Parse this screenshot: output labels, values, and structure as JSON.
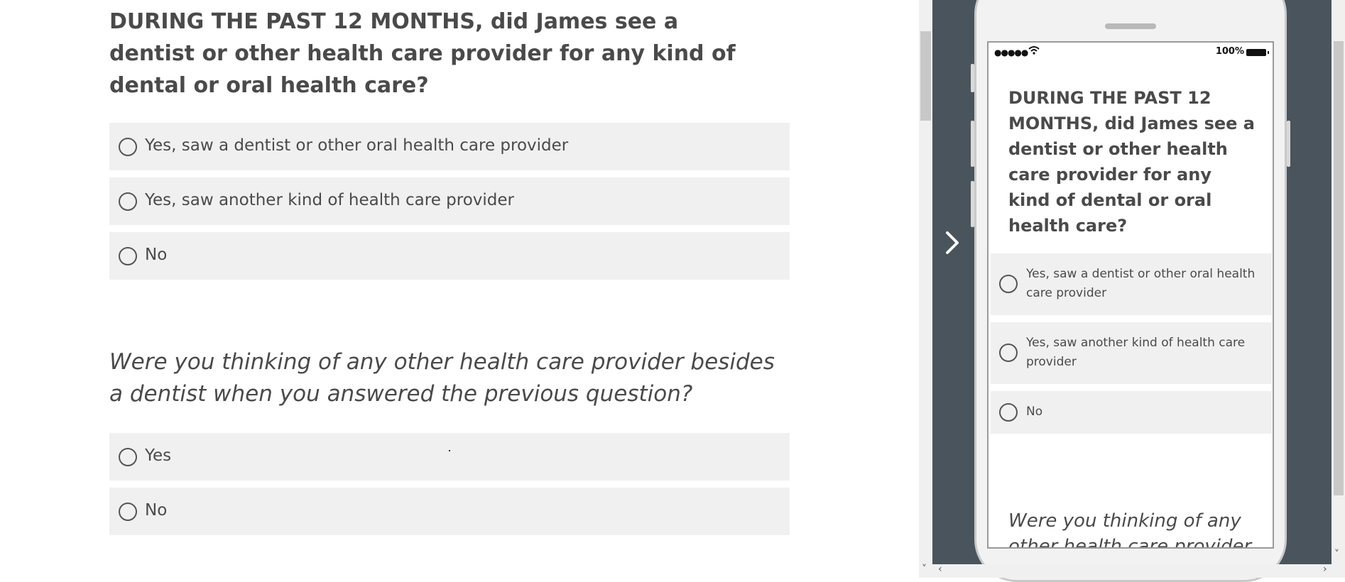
{
  "survey": {
    "question1": "DURING THE PAST 12 MONTHS, did James see a dentist or other health care provider for any kind of dental or oral health care?",
    "q1_options": [
      "Yes, saw a dentist or other oral health care provider",
      "Yes, saw another kind of health care provider",
      "No"
    ],
    "question2": "Were you thinking of any other health care provider besides a dentist when you answered the previous question?",
    "q2_options": [
      "Yes",
      "No"
    ]
  },
  "mobile_preview": {
    "battery": "100%",
    "signal": "●●●●●",
    "question1": "DURING THE PAST 12 MONTHS, did James see a dentist or other health care provider for any kind of dental or oral health care?",
    "q1_options": [
      "Yes, saw a dentist or other oral health care provider",
      "Yes, saw another kind of health care provider",
      "No"
    ],
    "question2_partial": "Were you thinking of any other health care provider"
  },
  "colors": {
    "preview_bg": "#4a545c",
    "option_bg": "#f0f0f0",
    "text": "#4a4a4a"
  },
  "icons": {
    "preview_next": "chevron-right-icon",
    "radio": "radio-circle-icon",
    "wifi": "wifi-icon",
    "battery": "battery-icon"
  }
}
